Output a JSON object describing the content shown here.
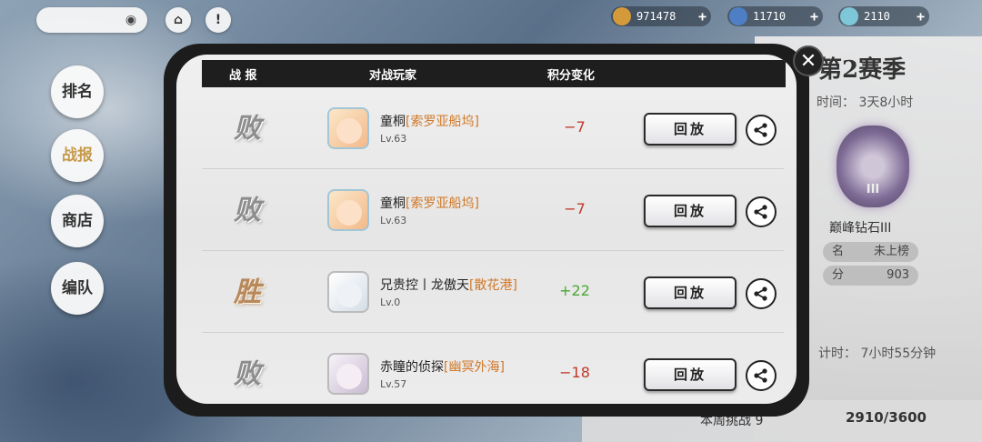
{
  "top_bar": {
    "currencies": [
      {
        "icon": "gold-coin-icon",
        "value": "971478",
        "color": "#d49a3a"
      },
      {
        "icon": "blue-crystal-icon",
        "value": "11710",
        "color": "#4e7fc4"
      },
      {
        "icon": "diamond-gem-icon",
        "value": "2110",
        "color": "#7ec7d8"
      }
    ],
    "plus": "+"
  },
  "side_nav": {
    "items": [
      {
        "label": "排名",
        "icon": "ranking-nav"
      },
      {
        "label": "战报",
        "icon": "battle-report-nav"
      },
      {
        "label": "商店",
        "icon": "shop-nav"
      },
      {
        "label": "编队",
        "icon": "formation-nav"
      }
    ]
  },
  "right_panel": {
    "season": "第2赛季",
    "time_left": "时间：  3天8小时",
    "badge_num": "III",
    "rank_name": "巅峰钻石III",
    "rank_label": "名",
    "rank_value": "未上榜",
    "score_label": "分",
    "score_value": "903",
    "countdown": "计时：  7小时55分钟",
    "battle_count": "本周挑战  9",
    "progress": "2910/3600"
  },
  "modal": {
    "headers": {
      "result": "战 报",
      "player": "对战玩家",
      "score_change": "积分变化"
    },
    "close": "✕",
    "replay_label": "回放",
    "rows": [
      {
        "result": "败",
        "outcome": "lose",
        "name": "童桐",
        "server": "[索罗亚船坞]",
        "level": "Lv.63",
        "score": "−7",
        "sign": "neg",
        "avatar": "anime-girl-orange-hair",
        "avatar_color": "#f3b98a"
      },
      {
        "result": "败",
        "outcome": "lose",
        "name": "童桐",
        "server": "[索罗亚船坞]",
        "level": "Lv.63",
        "score": "−7",
        "sign": "neg",
        "avatar": "anime-girl-orange-hair",
        "avatar_color": "#f3b98a"
      },
      {
        "result": "胜",
        "outcome": "win",
        "name": "兄贵控丨龙傲天",
        "server": "[散花港]",
        "level": "Lv.0",
        "score": "+22",
        "sign": "pos",
        "avatar": "anime-girl-silver-hair",
        "avatar_color": "#d5dde6"
      },
      {
        "result": "败",
        "outcome": "lose",
        "name": "赤瞳的侦探",
        "server": "[幽冥外海]",
        "level": "Lv.57",
        "score": "−18",
        "sign": "neg",
        "avatar": "anime-girl-white-hair",
        "avatar_color": "#e2dbe4"
      }
    ]
  }
}
